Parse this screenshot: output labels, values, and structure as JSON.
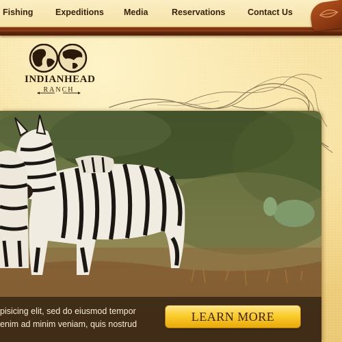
{
  "nav": {
    "items": [
      {
        "label": "Fishing"
      },
      {
        "label": "Expeditions"
      },
      {
        "label": "Media"
      },
      {
        "label": "Reservations"
      },
      {
        "label": "Contact Us"
      }
    ]
  },
  "brand": {
    "name": "INDIANHEAD",
    "sub": "RANCH"
  },
  "hero": {
    "image": "zebras-in-savanna",
    "caption_line1": "pisicing elit, sed do eiusmod tempor",
    "caption_line2": "enim ad minim veniam, quis nostrud",
    "cta_label": "LEARN MORE"
  },
  "colors": {
    "background": "#f3d98c",
    "wood": "#6b2a0c",
    "nav_text": "#3a1f08",
    "cta": "#fbcc2d"
  }
}
